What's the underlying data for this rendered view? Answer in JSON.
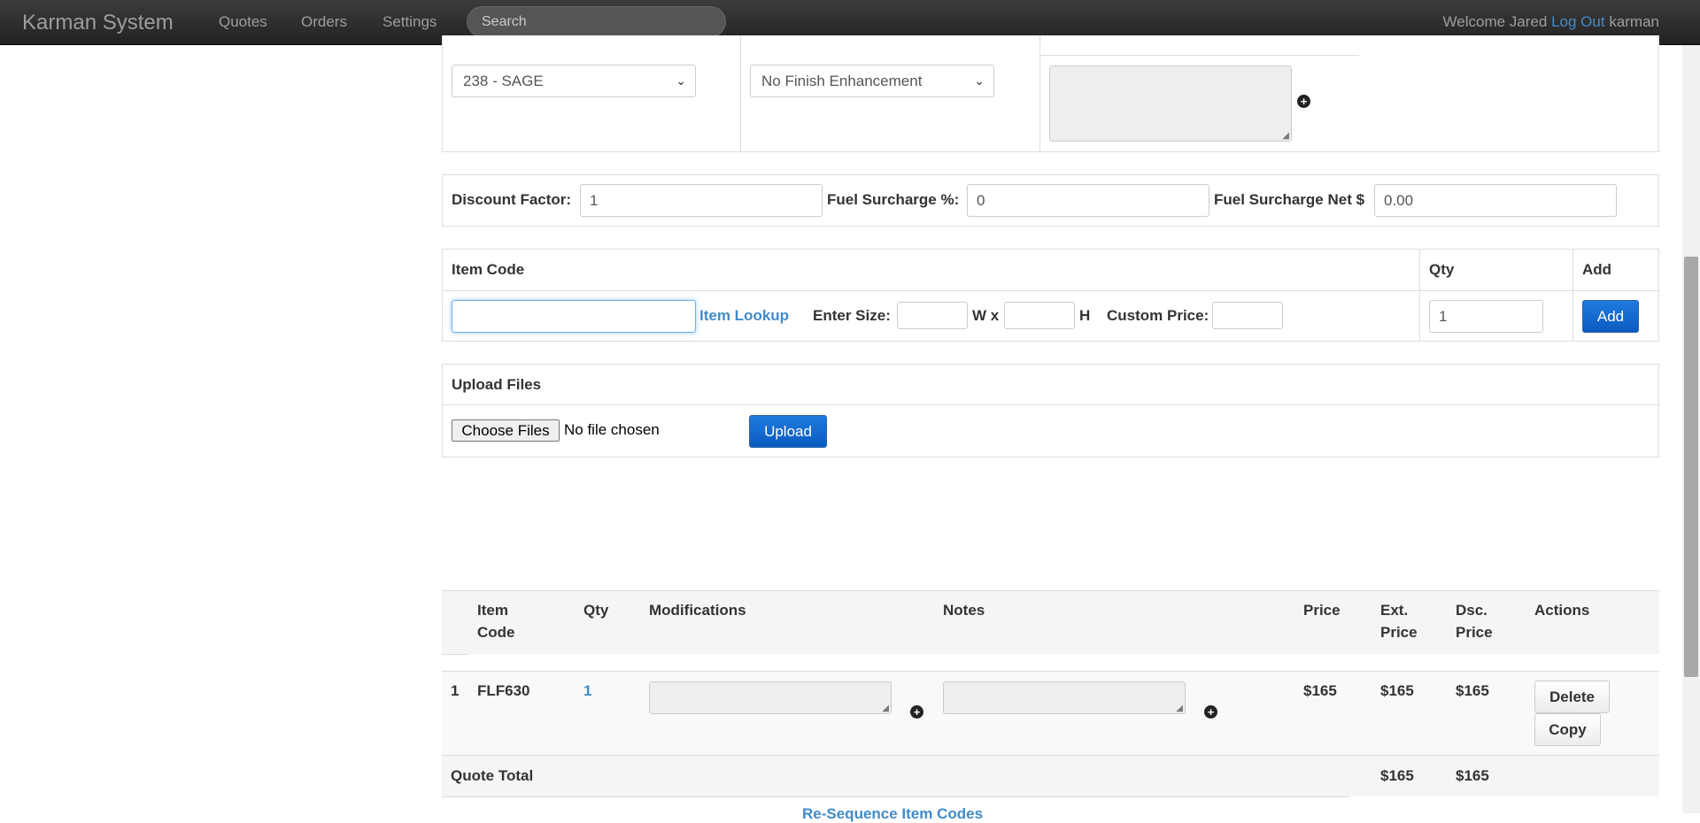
{
  "navbar": {
    "brand": "Karman System",
    "links": [
      "Quotes",
      "Orders",
      "Settings"
    ],
    "search_placeholder": "Search",
    "welcome": "Welcome Jared",
    "logout": "Log Out",
    "username": "karman"
  },
  "options_row": {
    "color_select": "238 - SAGE",
    "finish_select": "No Finish Enhancement"
  },
  "discount": {
    "discount_label": "Discount Factor:",
    "discount_value": "1",
    "fuel_pct_label": "Fuel Surcharge %:",
    "fuel_pct_value": "0",
    "fuel_net_label": "Fuel Surcharge Net $",
    "fuel_net_value": "0.00"
  },
  "item_entry": {
    "headers": {
      "item_code": "Item Code",
      "qty": "Qty",
      "add": "Add"
    },
    "item_lookup": "Item Lookup",
    "enter_size": "Enter Size:",
    "w_x": "W x",
    "h": "H",
    "custom_price": "Custom Price:",
    "qty_value": "1",
    "add_button": "Add"
  },
  "upload": {
    "title": "Upload Files",
    "choose_files": "Choose Files",
    "no_file": "No file chosen",
    "upload_button": "Upload"
  },
  "items_table": {
    "headers": {
      "item_code_1": "Item",
      "item_code_2": "Code",
      "qty": "Qty",
      "modifications": "Modifications",
      "notes": "Notes",
      "price": "Price",
      "ext_1": "Ext.",
      "ext_2": "Price",
      "dsc_1": "Dsc.",
      "dsc_2": "Price",
      "actions": "Actions"
    },
    "rows": [
      {
        "seq": "1",
        "item_code": "FLF630",
        "qty": "1",
        "price": "$165",
        "ext_price": "$165",
        "dsc_price": "$165"
      }
    ],
    "delete_button": "Delete",
    "copy_button": "Copy",
    "total_label": "Quote Total",
    "total_ext": "$165",
    "total_dsc": "$165",
    "resequence_link": "Re-Sequence Item Codes"
  }
}
